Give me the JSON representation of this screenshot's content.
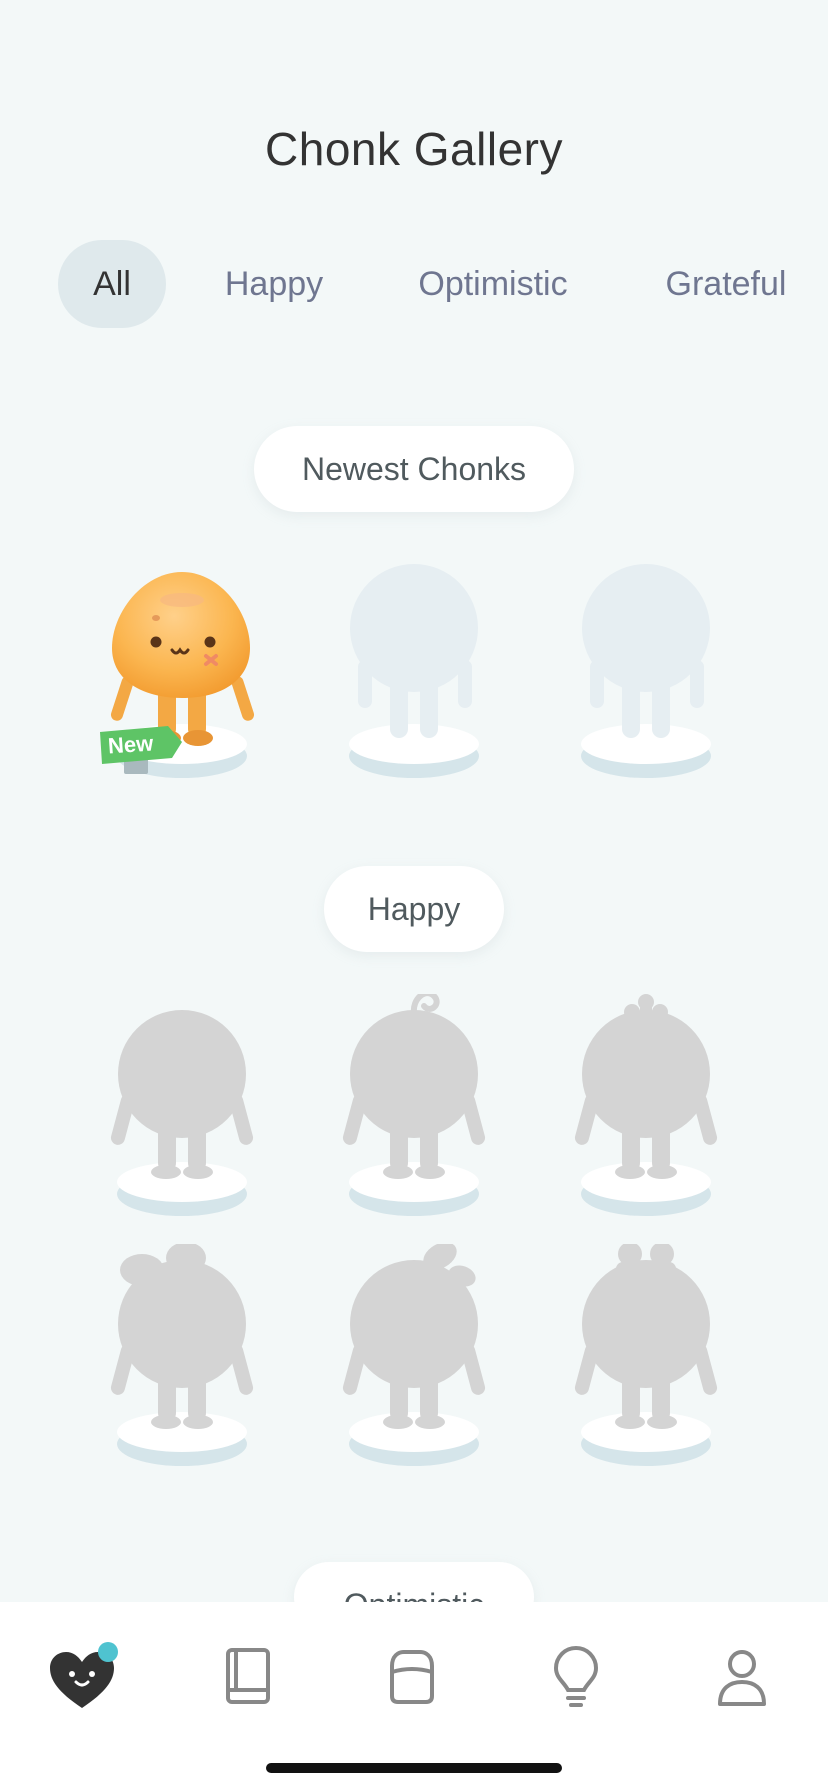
{
  "header": {
    "title": "Chonk Gallery"
  },
  "tabs": [
    {
      "label": "All",
      "active": true
    },
    {
      "label": "Happy",
      "active": false
    },
    {
      "label": "Optimistic",
      "active": false
    },
    {
      "label": "Grateful",
      "active": false
    }
  ],
  "sections": {
    "newest": {
      "title": "Newest Chonks",
      "new_badge": "New"
    },
    "happy": {
      "title": "Happy"
    },
    "optimistic": {
      "title": "Optimistic"
    }
  },
  "nav": {
    "items": [
      "heart-face-icon",
      "journal-icon",
      "folder-icon",
      "lightbulb-icon",
      "profile-icon"
    ],
    "notification_dot_color": "#4fc3d0"
  },
  "colors": {
    "background": "#f3f8f8",
    "active_tab_bg": "#dfe9ec",
    "chonk_orange": "#f7a938",
    "new_badge_green": "#5ec466",
    "silhouette_gray": "#d4d4d4",
    "placeholder_light": "#e6eef2"
  }
}
